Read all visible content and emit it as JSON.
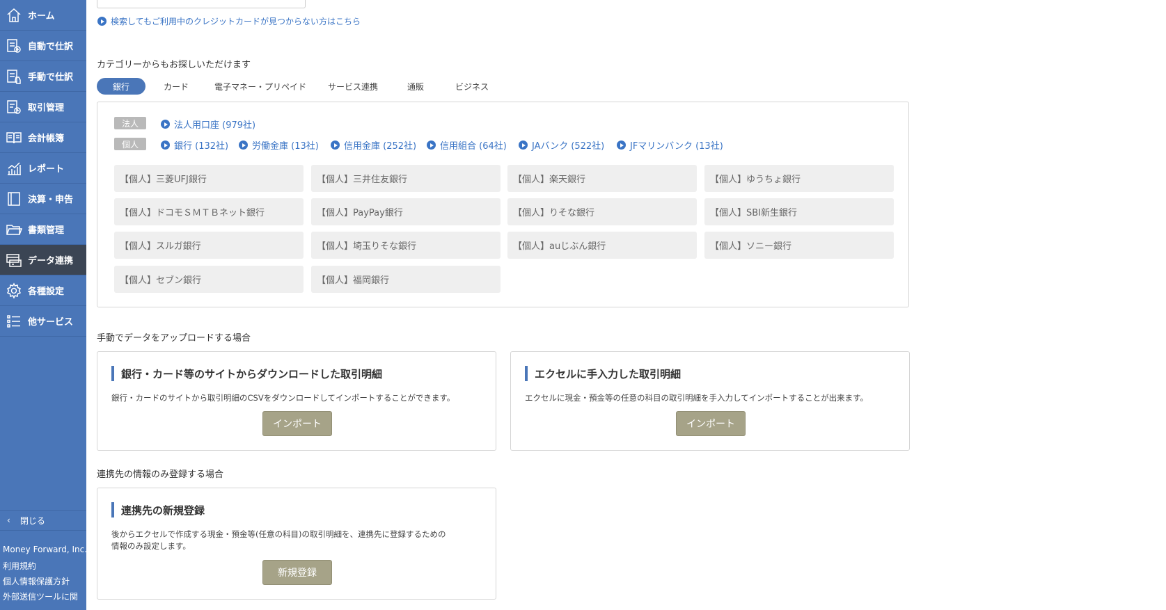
{
  "sidebar": {
    "items": [
      {
        "label": "ホーム",
        "icon": "home-icon"
      },
      {
        "label": "自動で仕訳",
        "icon": "auto-journal-icon"
      },
      {
        "label": "手動で仕訳",
        "icon": "manual-journal-icon"
      },
      {
        "label": "取引管理",
        "icon": "transaction-icon"
      },
      {
        "label": "会計帳簿",
        "icon": "ledger-book-icon"
      },
      {
        "label": "レポート",
        "icon": "report-chart-icon"
      },
      {
        "label": "決算・申告",
        "icon": "tax-filing-icon"
      },
      {
        "label": "書類管理",
        "icon": "folder-icon"
      },
      {
        "label": "データ連携",
        "icon": "data-link-icon",
        "active": true
      },
      {
        "label": "各種設定",
        "icon": "gear-icon"
      },
      {
        "label": "他サービス",
        "icon": "list-icon"
      }
    ],
    "close_label": "閉じる",
    "company": "Money Forward, Inc.",
    "links": [
      "利用規約",
      "個人情報保護方針",
      "外部送信ツールに関"
    ]
  },
  "main": {
    "help_link": "検索してもご利用中のクレジットカードが見つからない方はこちら",
    "category_title": "カテゴリーからもお探しいただけます",
    "tabs": [
      "銀行",
      "カード",
      "電子マネー・プリペイド",
      "サービス連携",
      "通販",
      "ビジネス"
    ],
    "active_tab": "銀行",
    "tags": {
      "corporate": "法人",
      "personal": "個人"
    },
    "corporate_links": [
      "法人用口座 (979社)"
    ],
    "personal_links": [
      "銀行 (132社)",
      "労働金庫 (13社)",
      "信用金庫 (252社)",
      "信用組合 (64社)",
      "JAバンク (522社)",
      "JFマリンバンク (13社)"
    ],
    "banks": [
      "【個人】三菱UFJ銀行",
      "【個人】三井住友銀行",
      "【個人】楽天銀行",
      "【個人】ゆうちょ銀行",
      "【個人】ドコモＳＭＴＢネット銀行",
      "【個人】PayPay銀行",
      "【個人】りそな銀行",
      "【個人】SBI新生銀行",
      "【個人】スルガ銀行",
      "【個人】埼玉りそな銀行",
      "【個人】auじぶん銀行",
      "【個人】ソニー銀行",
      "【個人】セブン銀行",
      "【個人】福岡銀行"
    ],
    "manual_title": "手動でデータをアップロードする場合",
    "card1": {
      "heading": "銀行・カード等のサイトからダウンロードした取引明細",
      "desc": "銀行・カードのサイトから取引明細のCSVをダウンロードしてインポートすることができます。",
      "button": "インポート"
    },
    "card2": {
      "heading": "エクセルに手入力した取引明細",
      "desc": "エクセルに現金・預金等の任意の科目の取引明細を手入力してインポートすることが出来ます。",
      "button": "インポート"
    },
    "register_title": "連携先の情報のみ登録する場合",
    "card3": {
      "heading": "連携先の新規登録",
      "desc_line1": "後からエクセルで作成する現金・預金等(任意の科目)の取引明細を、連携先に登録するための",
      "desc_line2": "情報のみ設定します。",
      "button": "新規登録"
    }
  }
}
